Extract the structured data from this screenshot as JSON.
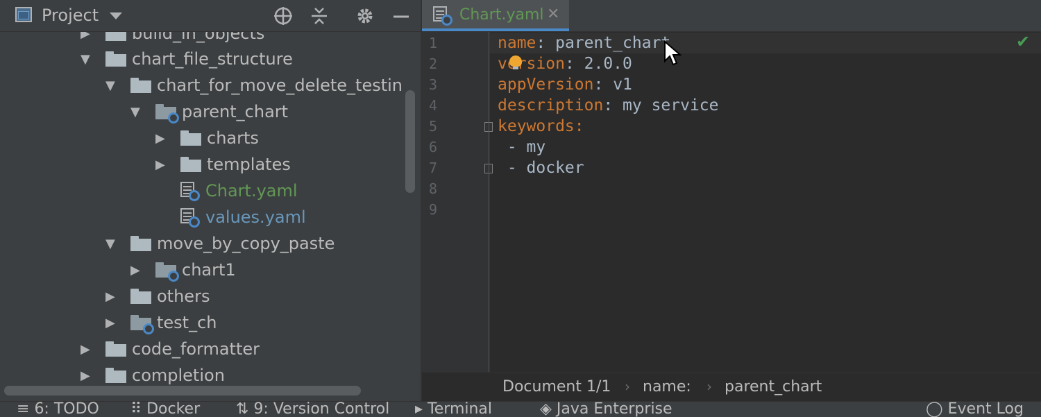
{
  "project_panel": {
    "title": "Project",
    "tree": [
      {
        "label": "build_in_objects",
        "arrow": "▶",
        "type": "folder"
      },
      {
        "label": "chart_file_structure",
        "arrow": "▼",
        "type": "folder"
      },
      {
        "label": "chart_for_move_delete_testin",
        "arrow": "▼",
        "type": "folder"
      },
      {
        "label": "parent_chart",
        "arrow": "▼",
        "type": "chart-folder"
      },
      {
        "label": "charts",
        "arrow": "▶",
        "type": "folder"
      },
      {
        "label": "templates",
        "arrow": "▶",
        "type": "folder"
      },
      {
        "label": "Chart.yaml",
        "arrow": "",
        "type": "chart-file"
      },
      {
        "label": "values.yaml",
        "arrow": "",
        "type": "values-file"
      },
      {
        "label": "move_by_copy_paste",
        "arrow": "▼",
        "type": "folder"
      },
      {
        "label": "chart1",
        "arrow": "▶",
        "type": "chart-folder"
      },
      {
        "label": "others",
        "arrow": "▶",
        "type": "folder"
      },
      {
        "label": "test_ch",
        "arrow": "▶",
        "type": "chart-folder"
      },
      {
        "label": "code_formatter",
        "arrow": "▶",
        "type": "folder"
      },
      {
        "label": "completion",
        "arrow": "▶",
        "type": "folder"
      }
    ]
  },
  "editor": {
    "tab_label": "Chart.yaml",
    "tab_close": "✕",
    "line_numbers": [
      "1",
      "2",
      "3",
      "4",
      "5",
      "6",
      "7",
      "8",
      "9"
    ],
    "lines": [
      {
        "key": "name",
        "sep": ": ",
        "value": "parent_chart"
      },
      {
        "key": "version",
        "sep": ": ",
        "value": "2.0.0"
      },
      {
        "key": "appVersion",
        "sep": ": ",
        "value": "v1"
      },
      {
        "key": "description",
        "sep": ": ",
        "value": "my service"
      },
      {
        "key": "keywords",
        "sep": ":",
        "value": ""
      },
      {
        "key": "",
        "sep": "",
        "value": " - my"
      },
      {
        "key": "",
        "sep": "",
        "value": " - docker"
      },
      {
        "key": "",
        "sep": "",
        "value": ""
      },
      {
        "key": "",
        "sep": "",
        "value": ""
      }
    ],
    "check_mark": "✔",
    "breadcrumb": {
      "doc": "Document 1/1",
      "sep": "›",
      "key": "name:",
      "value": "parent_chart"
    }
  },
  "status_bar": {
    "items": [
      "6: TODO",
      "Docker",
      "9: Version Control",
      "Terminal",
      "Java Enterprise",
      "Event Log"
    ]
  },
  "colors": {
    "yaml_key": "#cc7832",
    "yaml_value": "#a9b7c6",
    "tab_underline": "#4a88c7",
    "chart_file_text": "#629755",
    "values_file_text": "#6897bb",
    "bulb": "#f0a732",
    "check": "#499c54"
  }
}
